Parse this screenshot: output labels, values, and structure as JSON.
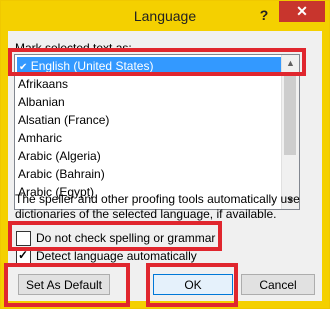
{
  "dialog": {
    "title": "Language",
    "help_label": "?",
    "close_label": "✕"
  },
  "language": {
    "instruction": "Mark selected text as:",
    "items": [
      {
        "label": "English (United States)",
        "selected": true
      },
      {
        "label": "Afrikaans"
      },
      {
        "label": "Albanian"
      },
      {
        "label": "Alsatian (France)"
      },
      {
        "label": "Amharic"
      },
      {
        "label": "Arabic (Algeria)"
      },
      {
        "label": "Arabic (Bahrain)"
      },
      {
        "label": "Arabic (Egypt)"
      }
    ],
    "info_text": "The speller and other proofing tools automatically use dictionaries of the selected language, if available.",
    "do_not_check_label": "Do not check spelling or grammar",
    "do_not_check_checked": false,
    "detect_label": "Detect language automatically",
    "detect_checked": true
  },
  "buttons": {
    "set_default": "Set As Default",
    "ok": "OK",
    "cancel": "Cancel"
  },
  "colors": {
    "highlight_box": "#e0262e",
    "selection": "#3399ff",
    "close_button": "#c8352d",
    "titlebar": "#f4d000"
  }
}
